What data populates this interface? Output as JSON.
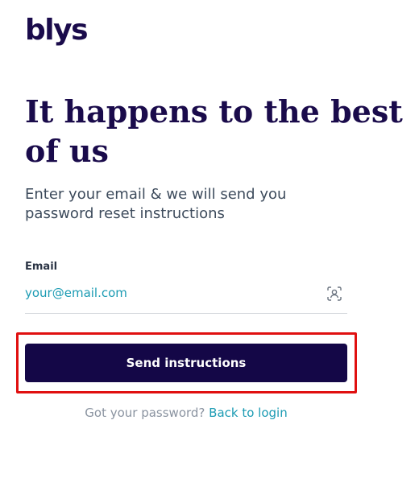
{
  "brand": {
    "logo_text": "blys",
    "color": "#1a0b4b"
  },
  "heading": {
    "title": "It happens to the best of us",
    "subtitle": "Enter your email & we will send you password reset instructions"
  },
  "form": {
    "email_label": "Email",
    "email_placeholder": "your@email.com",
    "email_value": "",
    "email_icon": "contact-card-icon",
    "submit_label": "Send instructions"
  },
  "footer": {
    "prompt": "Got your password?",
    "link_label": "Back to login"
  },
  "colors": {
    "primary": "#140747",
    "link": "#1b9bb3",
    "highlight": "#e01010"
  }
}
